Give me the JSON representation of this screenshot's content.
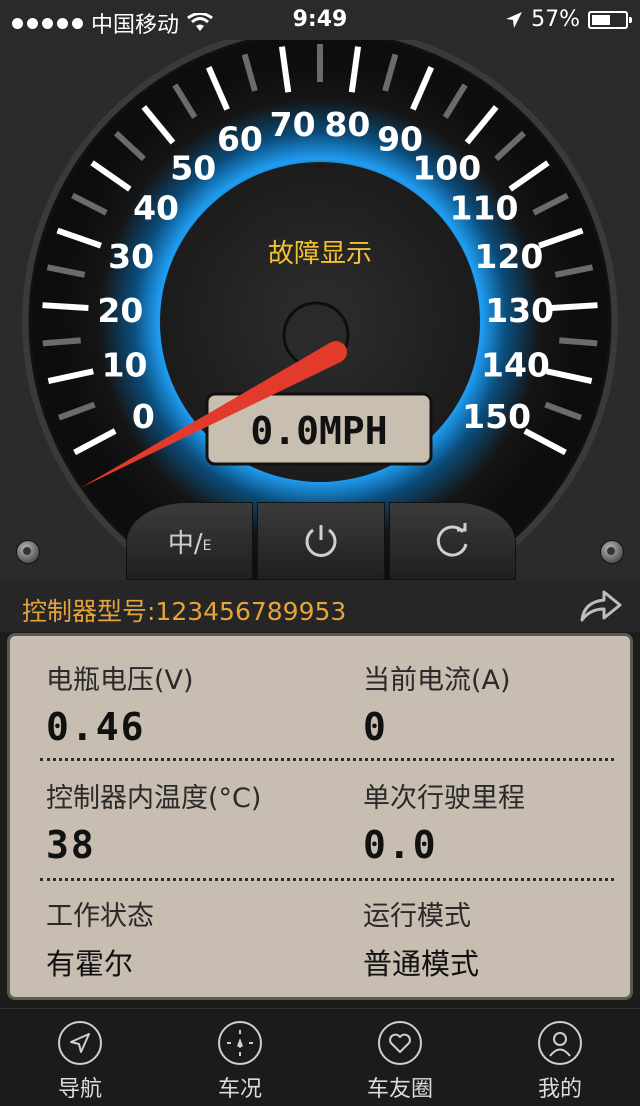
{
  "status_bar": {
    "carrier": "中国移动",
    "time": "9:49",
    "battery_text": "57%",
    "battery_level": 0.57
  },
  "gauge": {
    "title": "故障显示",
    "display": "0.0MPH",
    "speed_value": 0,
    "scale_min": 0,
    "scale_max": 150,
    "major_labels": [
      "0",
      "10",
      "20",
      "30",
      "40",
      "50",
      "60",
      "70",
      "80",
      "90",
      "100",
      "110",
      "120",
      "130",
      "140",
      "150"
    ],
    "colors": {
      "title": "#f2c230",
      "needle": "#e23a2b",
      "glow": "#1f9df2"
    }
  },
  "controls": {
    "lang_main": "中/",
    "lang_sub": "E",
    "power_icon": "power-icon",
    "refresh_icon": "refresh-icon"
  },
  "controller": {
    "label": "控制器型号:123456789953"
  },
  "metrics": {
    "battery_voltage": {
      "label": "电瓶电压(V)",
      "value": "0.46"
    },
    "current": {
      "label": "当前电流(A)",
      "value": "0"
    },
    "temperature": {
      "label": "控制器内温度(°C)",
      "value": "38"
    },
    "trip": {
      "label": "单次行驶里程",
      "value": "0.0"
    },
    "work_status": {
      "label": "工作状态",
      "value": "有霍尔"
    },
    "run_mode": {
      "label": "运行模式",
      "value": "普通模式"
    }
  },
  "tabs": [
    {
      "label": "导航",
      "icon": "navigation-icon"
    },
    {
      "label": "车况",
      "icon": "compass-icon"
    },
    {
      "label": "车友圈",
      "icon": "heart-icon"
    },
    {
      "label": "我的",
      "icon": "user-icon"
    }
  ]
}
